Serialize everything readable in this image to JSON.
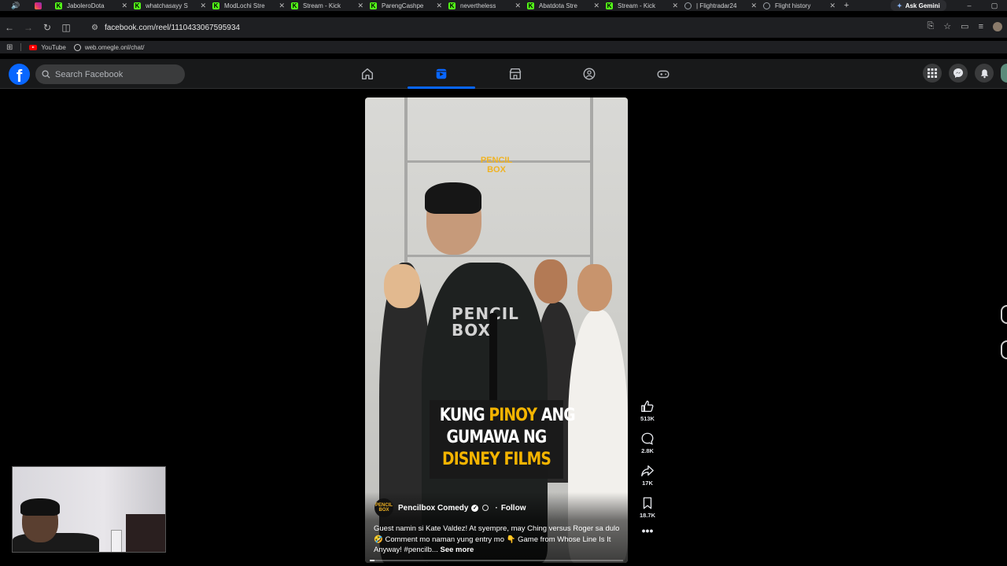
{
  "browser": {
    "tabs": [
      {
        "title": "JaboleroDota",
        "icon": "kick-icon",
        "color": "#53fc18"
      },
      {
        "title": "whatchasayy S",
        "icon": "kick-icon",
        "color": "#53fc18"
      },
      {
        "title": "ModLochi Stre",
        "icon": "kick-icon",
        "color": "#53fc18"
      },
      {
        "title": "Stream - Kick",
        "icon": "kick-icon",
        "color": "#53fc18"
      },
      {
        "title": "ParengCashpe",
        "icon": "kick-icon",
        "color": "#53fc18"
      },
      {
        "title": "nevertheless",
        "icon": "kick-icon",
        "color": "#53fc18"
      },
      {
        "title": "Abatdota Stre",
        "icon": "kick-icon",
        "color": "#53fc18"
      },
      {
        "title": "Stream - Kick",
        "icon": "kick-icon",
        "color": "#53fc18"
      },
      {
        "title": "| Flightradar24",
        "icon": "globe-icon",
        "color": "#9aa0a6"
      },
      {
        "title": "Flight history",
        "icon": "globe-icon",
        "color": "#9aa0a6"
      }
    ],
    "gemini_label": "Ask Gemini",
    "url": "facebook.com/reel/1110433067595934",
    "bookmarks": [
      {
        "label": "YouTube"
      },
      {
        "label": "web.omegle.onl/chat/"
      }
    ]
  },
  "facebook": {
    "search_placeholder": "Search Facebook",
    "brand_color": "#0866ff",
    "nav_active": "reels"
  },
  "reel": {
    "watermark": "PENCIL BOX",
    "shirt_text": "PENCIL BOX",
    "caption_line1_a": "KUNG",
    "caption_line1_b": "PINOY",
    "caption_line1_c": "ANG",
    "caption_line2": "GUMAWA NG",
    "caption_line3": "DISNEY FILMS",
    "avatar_text": "PENCIL BOX",
    "author": "Pencilbox Comedy",
    "follow": "Follow",
    "description": "Guest namin si Kate Valdez! At syempre, may Ching versus Roger sa dulo 🤣 Comment mo naman yung entry mo 👇 Game from Whose Line Is It Anyway! #pencilb...",
    "see_more": "See more",
    "progress": 0.02
  },
  "actions": {
    "likes": "513K",
    "comments": "2.8K",
    "shares": "17K",
    "saves": "18.7K"
  }
}
